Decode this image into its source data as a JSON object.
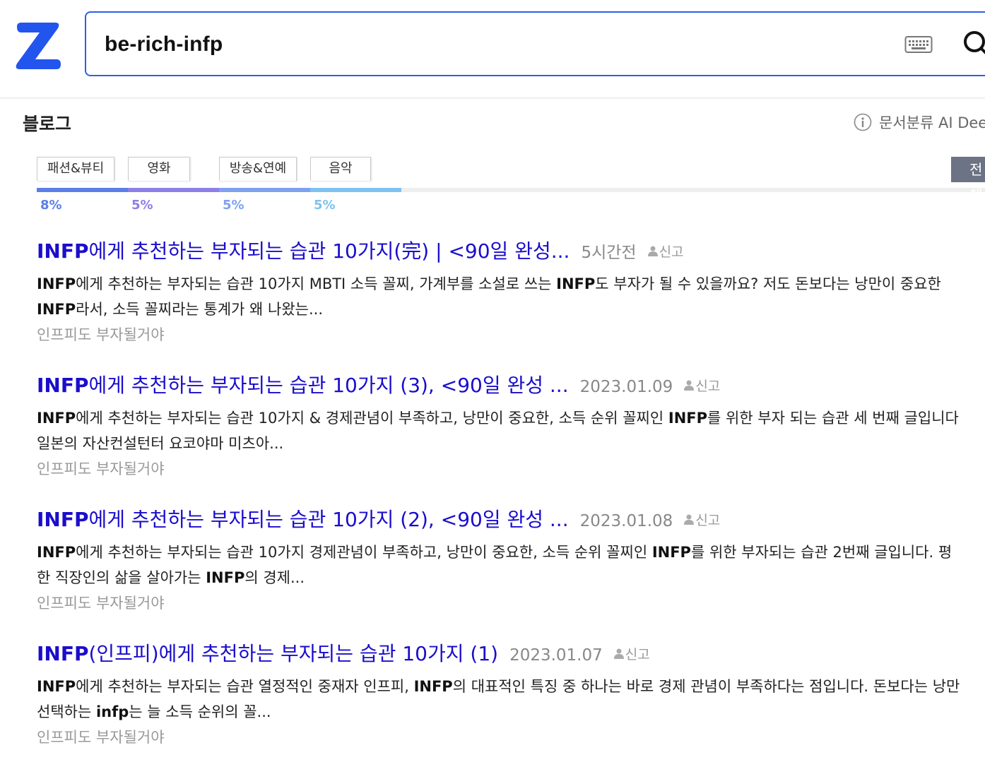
{
  "search": {
    "query": "be-rich-infp"
  },
  "section": {
    "title": "블로그",
    "classify_label": "문서분류 AI Deep"
  },
  "categories": [
    {
      "label": "패션&뷰티",
      "percent": "8%",
      "share": 0.08,
      "color": "#5b7fe6"
    },
    {
      "label": "영화",
      "percent": "5%",
      "share": 0.05,
      "color": "#8d7fe6"
    },
    {
      "label": "방송&연예",
      "percent": "5%",
      "share": 0.05,
      "color": "#7ea2ef"
    },
    {
      "label": "음악",
      "percent": "5%",
      "share": 0.05,
      "color": "#7ec2f0"
    }
  ],
  "all_button": "전체",
  "report_label": "신고",
  "results": [
    {
      "title_bold": "INFP",
      "title_rest": "에게 추천하는 부자되는 습관 10가지(完) | <90일 완성...",
      "date": "5시간전",
      "snippet_1": {
        "b1": "INFP",
        "t1": "에게 추천하는 부자되는 습관 10가지 MBTI 소득 꼴찌, 가계부를 소설로 쓰는 ",
        "b2": "INFP",
        "t2": "도 부자가 될 수 있을까요? 저도 돈보다는 낭만이 중요한"
      },
      "snippet_2": {
        "b1": "INFP",
        "t1": "라서, 소득 꼴찌라는 통계가 왜 나왔는...",
        "b2": "",
        "t2": ""
      },
      "source": "인프피도 부자될거야"
    },
    {
      "title_bold": "INFP",
      "title_rest": "에게 추천하는 부자되는 습관 10가지 (3), <90일 완성 ...",
      "date": "2023.01.09",
      "snippet_1": {
        "b1": "INFP",
        "t1": "에게 추천하는 부자되는 습관 10가지 & 경제관념이 부족하고, 낭만이 중요한, 소득 순위 꼴찌인 ",
        "b2": "INFP",
        "t2": "를 위한 부자 되는 습관 세 번째 글입니다"
      },
      "snippet_2": {
        "b1": "",
        "t1": "일본의 자산컨설턴터 요코야마 미츠아...",
        "b2": "",
        "t2": ""
      },
      "source": "인프피도 부자될거야"
    },
    {
      "title_bold": "INFP",
      "title_rest": "에게 추천하는 부자되는 습관 10가지 (2), <90일 완성 ...",
      "date": "2023.01.08",
      "snippet_1": {
        "b1": "INFP",
        "t1": "에게 추천하는 부자되는 습관 10가지 경제관념이 부족하고, 낭만이 중요한, 소득 순위 꼴찌인 ",
        "b2": "INFP",
        "t2": "를 위한 부자되는 습관 2번째 글입니다. 평"
      },
      "snippet_2": {
        "b1": "",
        "t1": "한 직장인의 삶을 살아가는 ",
        "b2": "INFP",
        "t2": "의 경제..."
      },
      "source": "인프피도 부자될거야"
    },
    {
      "title_bold": "INFP",
      "title_rest": "(인프피)에게 추천하는 부자되는 습관 10가지 (1)",
      "date": "2023.01.07",
      "snippet_1": {
        "b1": "INFP",
        "t1": "에게 추천하는 부자되는 습관 열정적인 중재자 인프피, ",
        "b2": "INFP",
        "t2": "의 대표적인 특징 중 하나는 바로 경제 관념이 부족하다는 점입니다. 돈보다는 낭만"
      },
      "snippet_2": {
        "b1": "",
        "t1": "선택하는 ",
        "b2": "infp",
        "t2": "는 늘 소득 순위의 꼴..."
      },
      "source": "인프피도 부자될거야"
    }
  ]
}
